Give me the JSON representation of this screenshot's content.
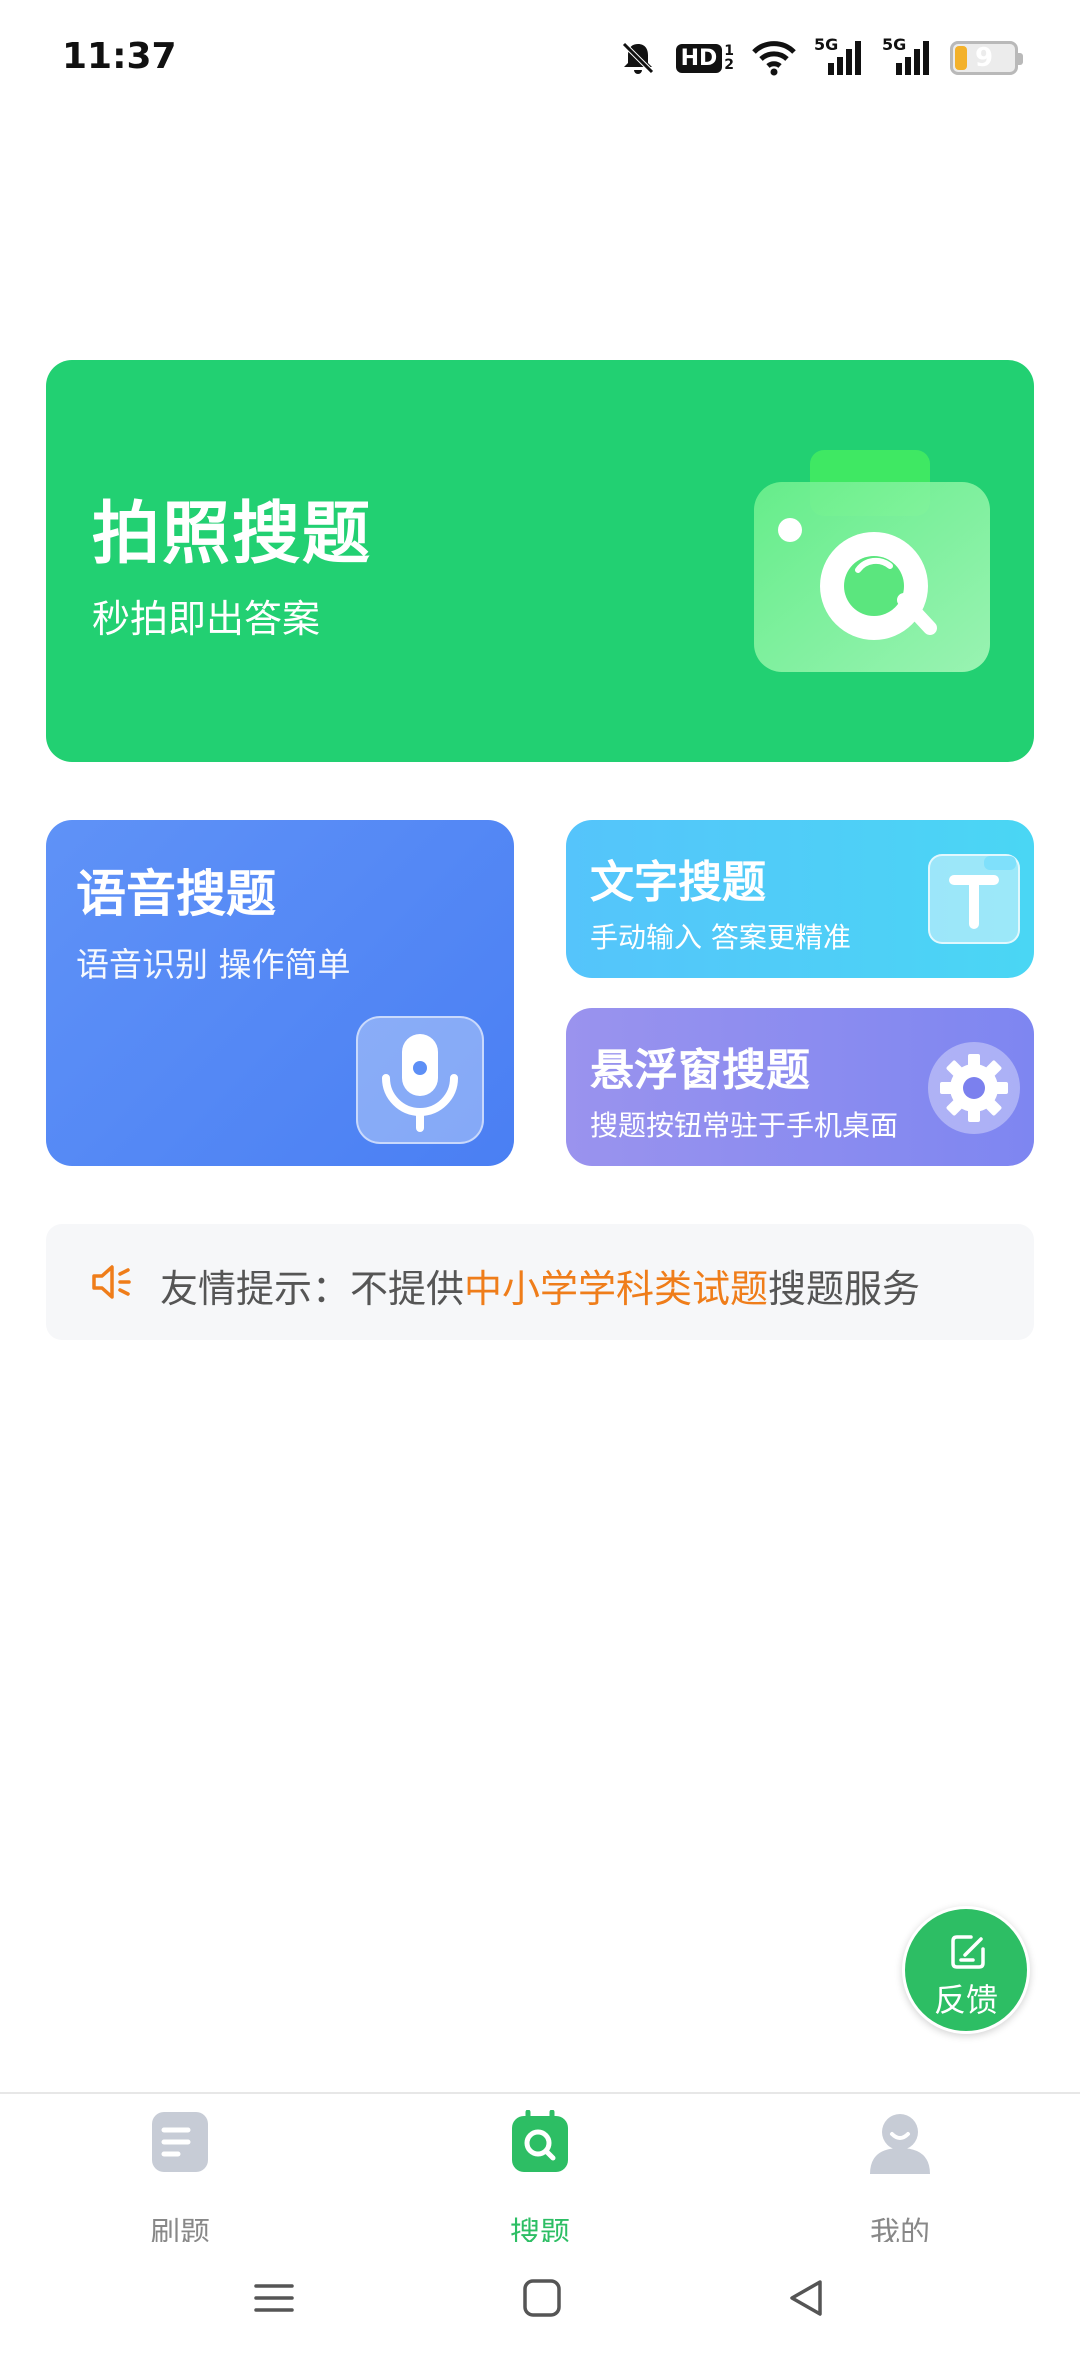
{
  "status_bar": {
    "time": "11:37",
    "hd_label": "HD",
    "network_label_1": "5G",
    "network_label_2": "5G",
    "battery_level": "9",
    "icons": [
      "bell-off-icon",
      "hd-icon",
      "wifi-icon",
      "signal-icon",
      "signal-icon",
      "battery-icon"
    ]
  },
  "cards": {
    "photo": {
      "title": "拍照搜题",
      "subtitle": "秒拍即出答案",
      "icon": "camera-icon",
      "color": "#22d072"
    },
    "voice": {
      "title": "语音搜题",
      "subtitle": "语音识别 操作简单",
      "icon": "microphone-icon",
      "color": "#4a7ff3"
    },
    "text": {
      "title": "文字搜题",
      "subtitle": "手动输入 答案更精准",
      "icon": "text-t-icon",
      "color": "#4ad6f4"
    },
    "floating": {
      "title": "悬浮窗搜题",
      "subtitle": "搜题按钮常驻于手机桌面",
      "icon": "gear-icon",
      "color": "#7e86f1"
    }
  },
  "notice": {
    "prefix": "友情提示：不提供",
    "highlight": "中小学学科类试题",
    "suffix": "搜题服务",
    "highlight_color": "#ef7d1a",
    "icon": "speaker-icon"
  },
  "fab": {
    "label": "反馈",
    "icon": "edit-icon"
  },
  "tabbar": {
    "items": [
      {
        "label": "刷题",
        "icon": "document-icon",
        "active": false
      },
      {
        "label": "搜题",
        "icon": "search-icon",
        "active": true
      },
      {
        "label": "我的",
        "icon": "user-icon",
        "active": false
      }
    ],
    "active_color": "#2dbe64"
  },
  "navbar": {
    "icons": [
      "menu-icon",
      "home-icon",
      "back-icon"
    ]
  }
}
